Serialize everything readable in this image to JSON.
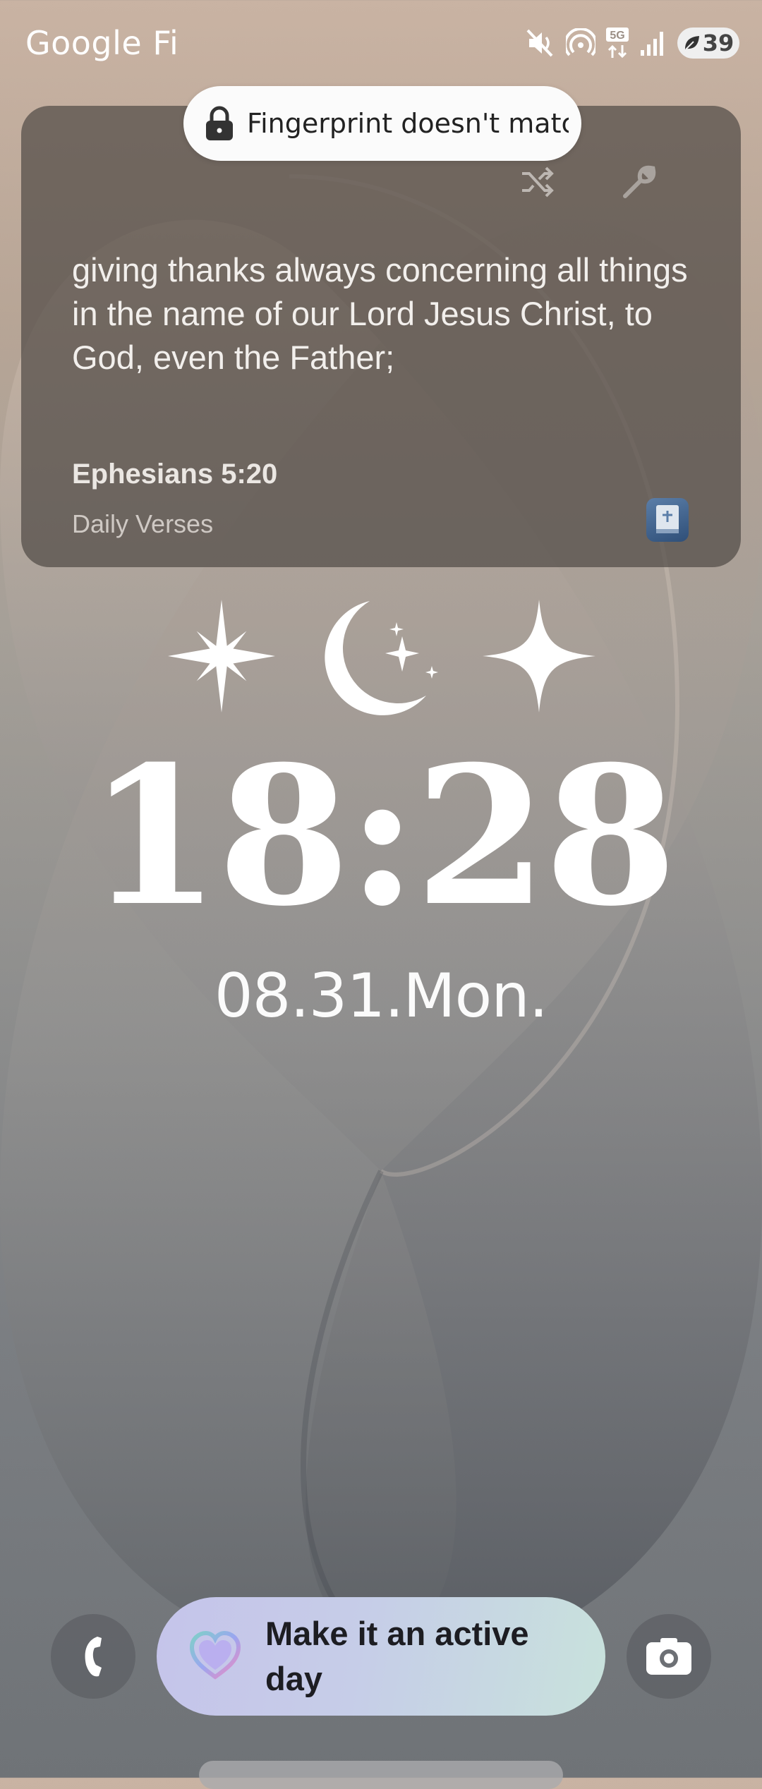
{
  "status_bar": {
    "carrier": "Google Fi",
    "network": "5G",
    "battery": "39",
    "icons": [
      "mute-icon",
      "hotspot-icon",
      "5g-icon",
      "signal-icon",
      "battery-icon"
    ]
  },
  "toast": {
    "text": "Fingerprint doesn't match",
    "icon": "lock-icon"
  },
  "widget": {
    "verse": "giving thanks always concerning all things in the name of our Lord Jesus Christ, to God, even the Father;",
    "reference": "Ephesians 5:20",
    "app_name": "Daily Verses",
    "icons": [
      "shuffle-icon",
      "wrench-icon",
      "bible-app-icon"
    ]
  },
  "lockscreen": {
    "time": "18:28",
    "date": "08.31.Mon.",
    "weather_icons": [
      "sparkle-icon",
      "crescent-moon-icon",
      "star-icon"
    ]
  },
  "bottom": {
    "left_shortcut": "phone-icon",
    "right_shortcut": "camera-icon",
    "activity_text": "Make it an active day",
    "activity_icon": "heart-icon"
  },
  "colors": {
    "wallpaper_top": "#c9b3a3",
    "wallpaper_bottom": "#6f7377",
    "widget_bg": "#4e4844",
    "activity_gradient": [
      "#c5c4ea",
      "#c8e2dc"
    ]
  }
}
